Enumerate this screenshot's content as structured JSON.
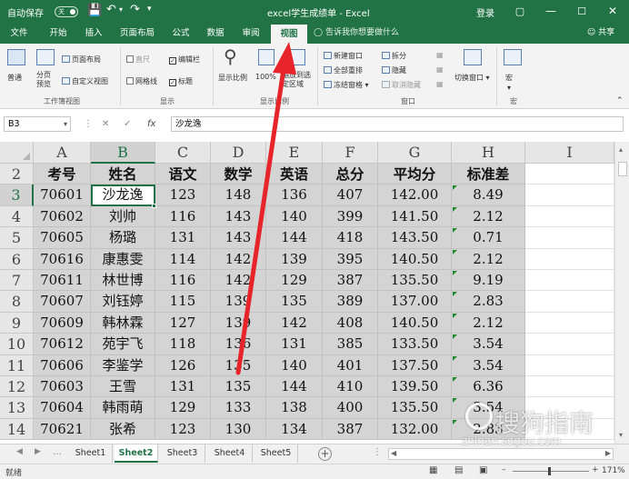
{
  "titlebar": {
    "autosave_label": "自动保存",
    "autosave_state": "关",
    "title": "excel学生成绩单 - Excel",
    "login": "登录"
  },
  "ribbon_tabs": [
    "文件",
    "开始",
    "插入",
    "页面布局",
    "公式",
    "数据",
    "审阅",
    "视图"
  ],
  "active_tab": "视图",
  "tell_me": "告诉我你想要做什么",
  "share": "共享",
  "ribbon": {
    "workbook_views": {
      "normal": "普通",
      "page_break": "分页预览",
      "page_layout": "页面布局",
      "custom_views": "自定义视图",
      "label": "工作簿视图"
    },
    "show": {
      "ruler": "直尺",
      "formula_bar": "编辑栏",
      "gridlines": "网格线",
      "headings": "标题",
      "label": "显示"
    },
    "zoom": {
      "zoom": "显示比例",
      "hundred": "100%",
      "zoom_to_selection": "缩放到选定区域",
      "label": "显示比例"
    },
    "window": {
      "new_window": "新建窗口",
      "arrange_all": "全部重排",
      "freeze_panes": "冻结窗格",
      "split": "拆分",
      "hide": "隐藏",
      "unhide": "取消隐藏",
      "switch_windows": "切换窗口",
      "label": "窗口"
    },
    "macros": {
      "macros": "宏",
      "label": "宏"
    }
  },
  "formula_bar": {
    "name_box": "B3",
    "fx": "fx",
    "content": "沙龙逸"
  },
  "columns": [
    "A",
    "B",
    "C",
    "D",
    "E",
    "F",
    "G",
    "H",
    "I"
  ],
  "rows": [
    "2",
    "3",
    "4",
    "5",
    "6",
    "7",
    "8",
    "9",
    "10",
    "11",
    "12",
    "13",
    "14"
  ],
  "table": {
    "headers": [
      "考号",
      "姓名",
      "语文",
      "数学",
      "英语",
      "总分",
      "平均分",
      "标准差"
    ],
    "data": [
      [
        "70601",
        "沙龙逸",
        "123",
        "148",
        "136",
        "407",
        "142.00",
        "8.49"
      ],
      [
        "70602",
        "刘帅",
        "116",
        "143",
        "140",
        "399",
        "141.50",
        "2.12"
      ],
      [
        "70605",
        "杨璐",
        "131",
        "143",
        "144",
        "418",
        "143.50",
        "0.71"
      ],
      [
        "70616",
        "康惠雯",
        "114",
        "142",
        "139",
        "395",
        "140.50",
        "2.12"
      ],
      [
        "70611",
        "林世博",
        "116",
        "142",
        "129",
        "387",
        "135.50",
        "9.19"
      ],
      [
        "70607",
        "刘钰婷",
        "115",
        "139",
        "135",
        "389",
        "137.00",
        "2.83"
      ],
      [
        "70609",
        "韩林霖",
        "127",
        "139",
        "142",
        "408",
        "140.50",
        "2.12"
      ],
      [
        "70612",
        "苑宇飞",
        "118",
        "136",
        "131",
        "385",
        "133.50",
        "3.54"
      ],
      [
        "70606",
        "李鉴学",
        "126",
        "135",
        "140",
        "401",
        "137.50",
        "3.54"
      ],
      [
        "70603",
        "王雪",
        "131",
        "135",
        "144",
        "410",
        "139.50",
        "6.36"
      ],
      [
        "70604",
        "韩雨萌",
        "129",
        "133",
        "138",
        "400",
        "135.50",
        "3.54"
      ],
      [
        "70621",
        "张希",
        "123",
        "130",
        "134",
        "387",
        "132.00",
        "2.83"
      ]
    ]
  },
  "sheets": [
    "Sheet1",
    "Sheet2",
    "Sheet3",
    "Sheet4",
    "Sheet5"
  ],
  "active_sheet": "Sheet2",
  "status": {
    "ready": "就绪",
    "zoom": "171%"
  },
  "watermark": {
    "main": "搜狗指南",
    "sub": "zhinan.sogou.com"
  },
  "colors": {
    "accent": "#217346",
    "arrow": "#e8242b",
    "selection_fill": "#d4d4d4"
  }
}
